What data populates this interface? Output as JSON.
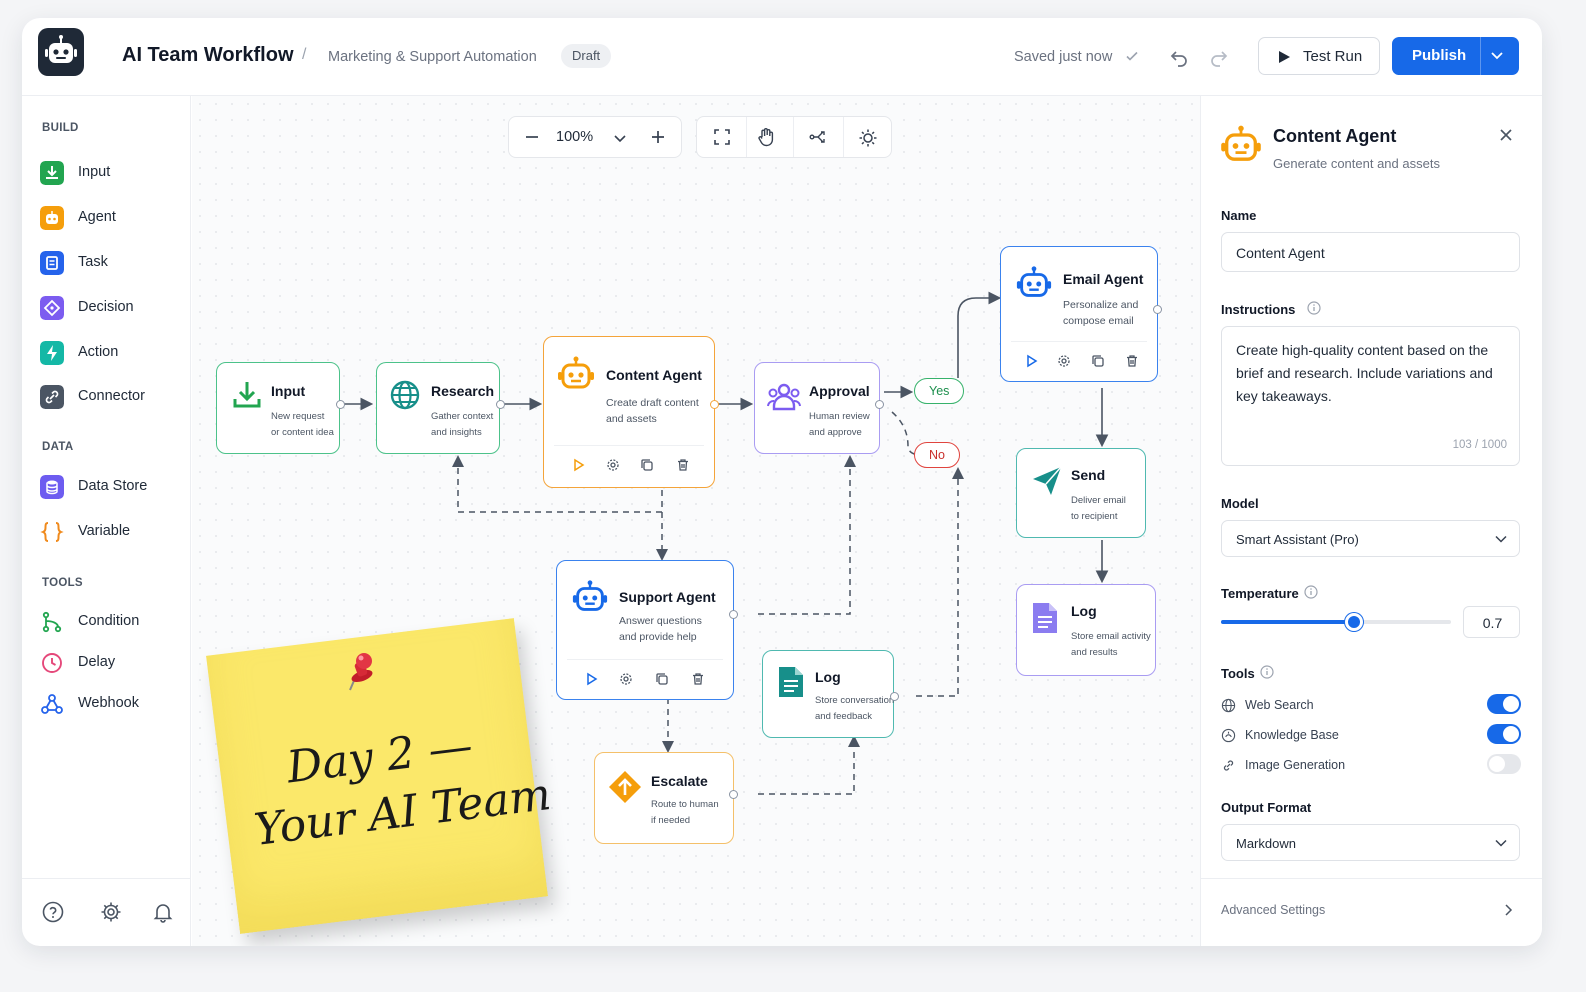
{
  "header": {
    "title": "AI Team Workflow",
    "separator": "/",
    "subtitle": "Marketing & Support Automation",
    "badge": "Draft",
    "saved_text": "Saved just now",
    "test_run_label": "Test Run",
    "publish_label": "Publish"
  },
  "sidebar": {
    "sections": [
      {
        "title": "BUILD",
        "items": [
          {
            "label": "Input",
            "icon": "download-icon",
            "color": "#22a550"
          },
          {
            "label": "Agent",
            "icon": "robot-icon",
            "color": "#f59e0b"
          },
          {
            "label": "Task",
            "icon": "task-icon",
            "color": "#2563eb"
          },
          {
            "label": "Decision",
            "icon": "diamond-icon",
            "color": "#7c5cf0"
          },
          {
            "label": "Action",
            "icon": "bolt-icon",
            "color": "#14b8a6"
          },
          {
            "label": "Connector",
            "icon": "link-icon",
            "color": "#4b5563"
          }
        ]
      },
      {
        "title": "DATA",
        "items": [
          {
            "label": "Data Store",
            "icon": "database-icon",
            "color": "#6d5cf0"
          },
          {
            "label": "Variable",
            "icon": "braces-icon",
            "color": "#f08a1c"
          }
        ]
      },
      {
        "title": "TOOLS",
        "items": [
          {
            "label": "Condition",
            "icon": "branch-icon",
            "color": "#22a550"
          },
          {
            "label": "Delay",
            "icon": "clock-icon",
            "color": "#e5487a"
          },
          {
            "label": "Webhook",
            "icon": "webhook-icon",
            "color": "#2563eb"
          }
        ]
      }
    ]
  },
  "canvas": {
    "zoom": "100%",
    "nodes": {
      "input": {
        "title": "Input",
        "desc": [
          "New request",
          "or content idea"
        ]
      },
      "research": {
        "title": "Research",
        "desc": [
          "Gather context",
          "and insights"
        ]
      },
      "content_agent": {
        "title": "Content Agent",
        "desc": [
          "Create draft content",
          "and assets"
        ]
      },
      "approval": {
        "title": "Approval",
        "desc": [
          "Human review",
          "and approve"
        ]
      },
      "email_agent": {
        "title": "Email Agent",
        "desc": [
          "Personalize and",
          "compose email"
        ]
      },
      "send": {
        "title": "Send",
        "desc": [
          "Deliver email",
          "to recipient"
        ]
      },
      "log_email": {
        "title": "Log",
        "desc": [
          "Store email activity",
          "and results"
        ]
      },
      "support_agent": {
        "title": "Support Agent",
        "desc": [
          "Answer questions",
          "and provide help"
        ]
      },
      "log_support": {
        "title": "Log",
        "desc": [
          "Store conversation",
          "and feedback"
        ]
      },
      "escalate": {
        "title": "Escalate",
        "desc": [
          "Route to human",
          "if needed"
        ]
      }
    },
    "yes_label": "Yes",
    "no_label": "No",
    "sticky_note": [
      "Day 2 —",
      "Your AI Team"
    ]
  },
  "panel": {
    "title": "Content Agent",
    "subtitle": "Generate content and assets",
    "name_label": "Name",
    "name_value": "Content Agent",
    "instructions_label": "Instructions",
    "instructions_value": "Create high-quality content based on the brief and research. Include variations and key takeaways.",
    "char_count": "103 / 1000",
    "model_label": "Model",
    "model_value": "Smart Assistant (Pro)",
    "temperature_label": "Temperature",
    "temperature_value": "0.7",
    "temperature_fraction": 0.58,
    "tools_label": "Tools",
    "tools": [
      {
        "label": "Web Search",
        "icon": "globe-icon",
        "enabled": true
      },
      {
        "label": "Knowledge Base",
        "icon": "knowledge-icon",
        "enabled": true
      },
      {
        "label": "Image Generation",
        "icon": "link-icon",
        "enabled": false
      }
    ],
    "output_label": "Output Format",
    "output_value": "Markdown",
    "advanced_label": "Advanced Settings"
  },
  "colors": {
    "accent": "#1769e8",
    "green": "#22a550",
    "orange": "#f59e0b",
    "purple": "#8b7cf0",
    "teal": "#2aa198",
    "red": "#e0443e"
  }
}
